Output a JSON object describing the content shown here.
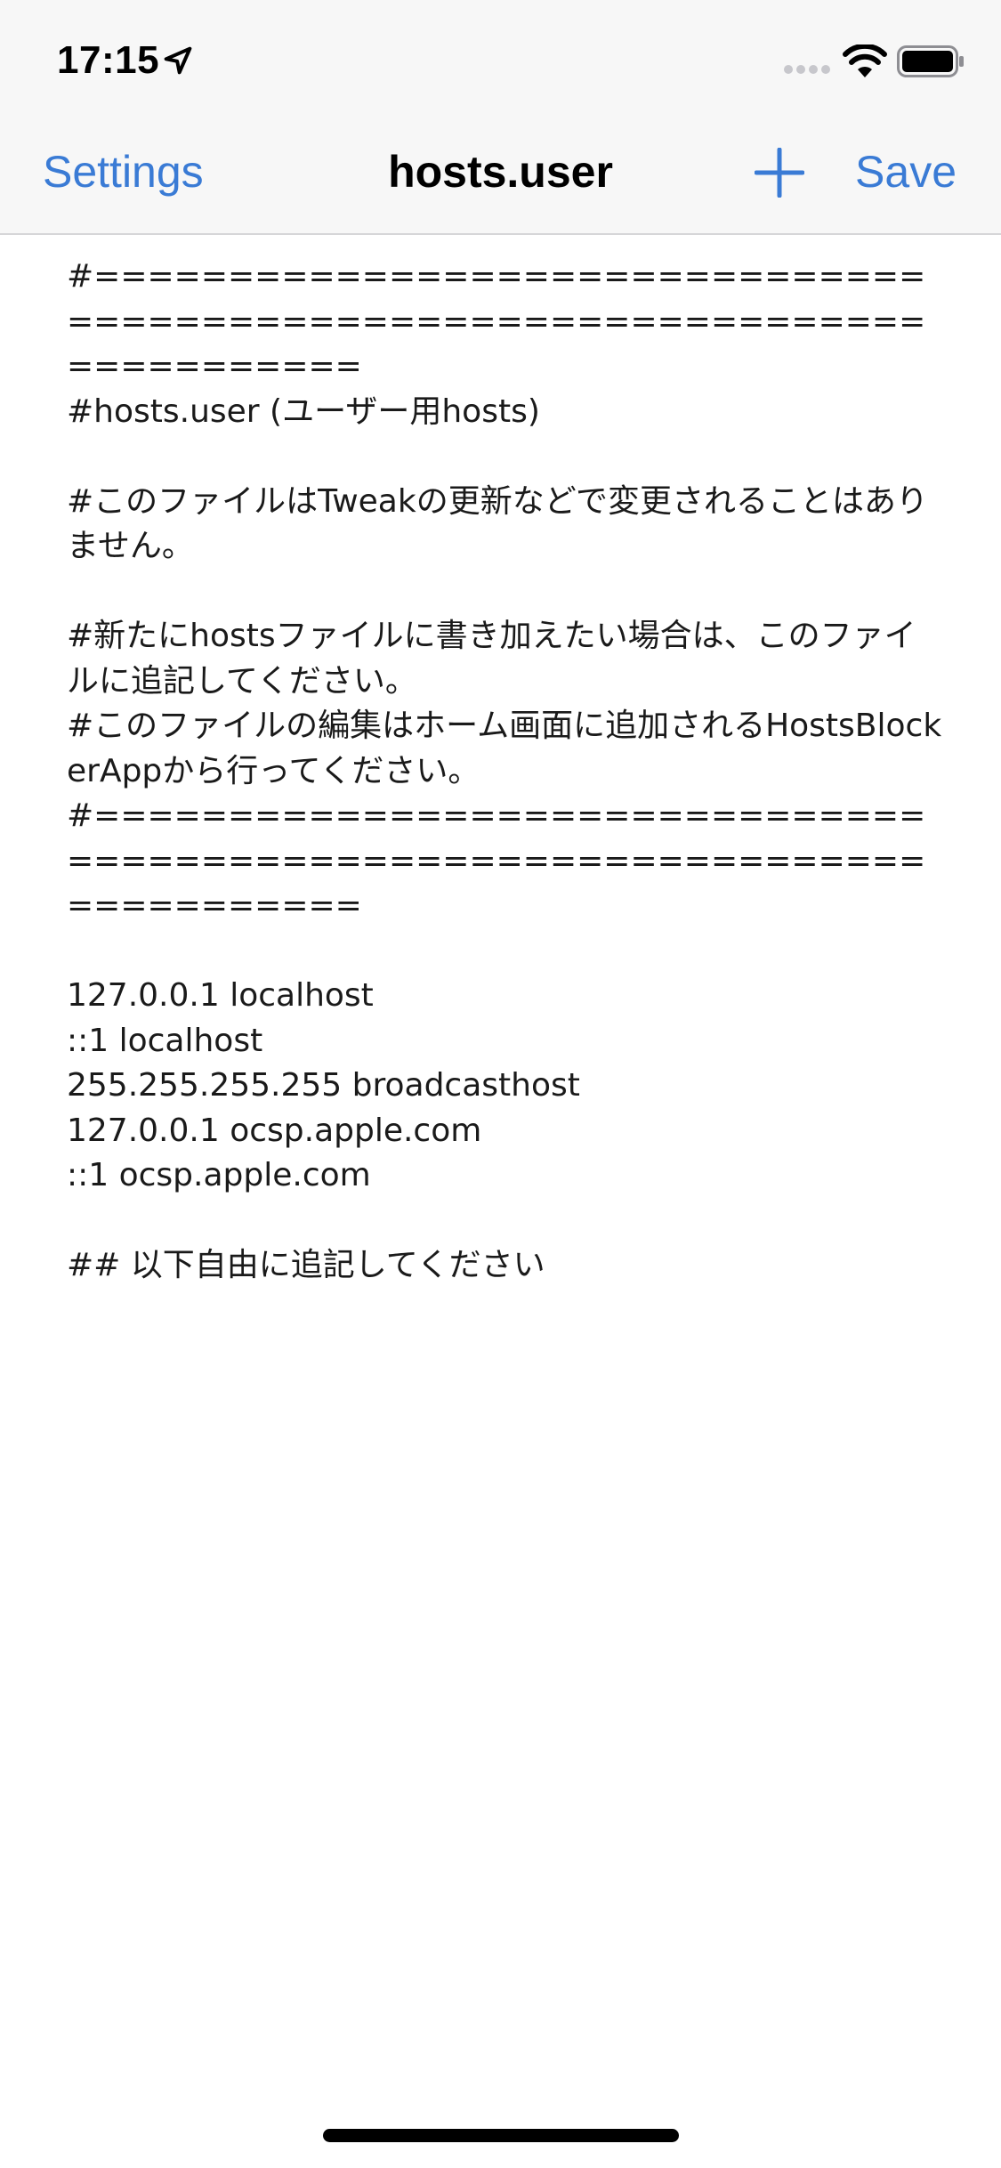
{
  "status_bar": {
    "time": "17:15",
    "icons": [
      "location-arrow-icon",
      "cellular-signal-icon",
      "wifi-icon",
      "battery-icon"
    ]
  },
  "nav": {
    "back_label": "Settings",
    "title": "hosts.user",
    "add_icon": "plus-icon",
    "save_label": "Save"
  },
  "editor": {
    "content": "#==========================================================================\n#hosts.user (ユーザー用hosts)\n\n#このファイルはTweakの更新などで変更されることはありません。\n\n#新たにhostsファイルに書き加えたい場合は、このファイルに追記してください。\n#このファイルの編集はホーム画面に追加されるHostsBlockerAppから行ってください。\n#==========================================================================\n\n127.0.0.1 localhost\n::1 localhost\n255.255.255.255 broadcasthost\n127.0.0.1 ocsp.apple.com\n::1 ocsp.apple.com\n\n## 以下自由に追記してください"
  },
  "colors": {
    "accent": "#3a7bd5",
    "bar_background": "#f7f7f7",
    "text": "#1a1a1a"
  }
}
